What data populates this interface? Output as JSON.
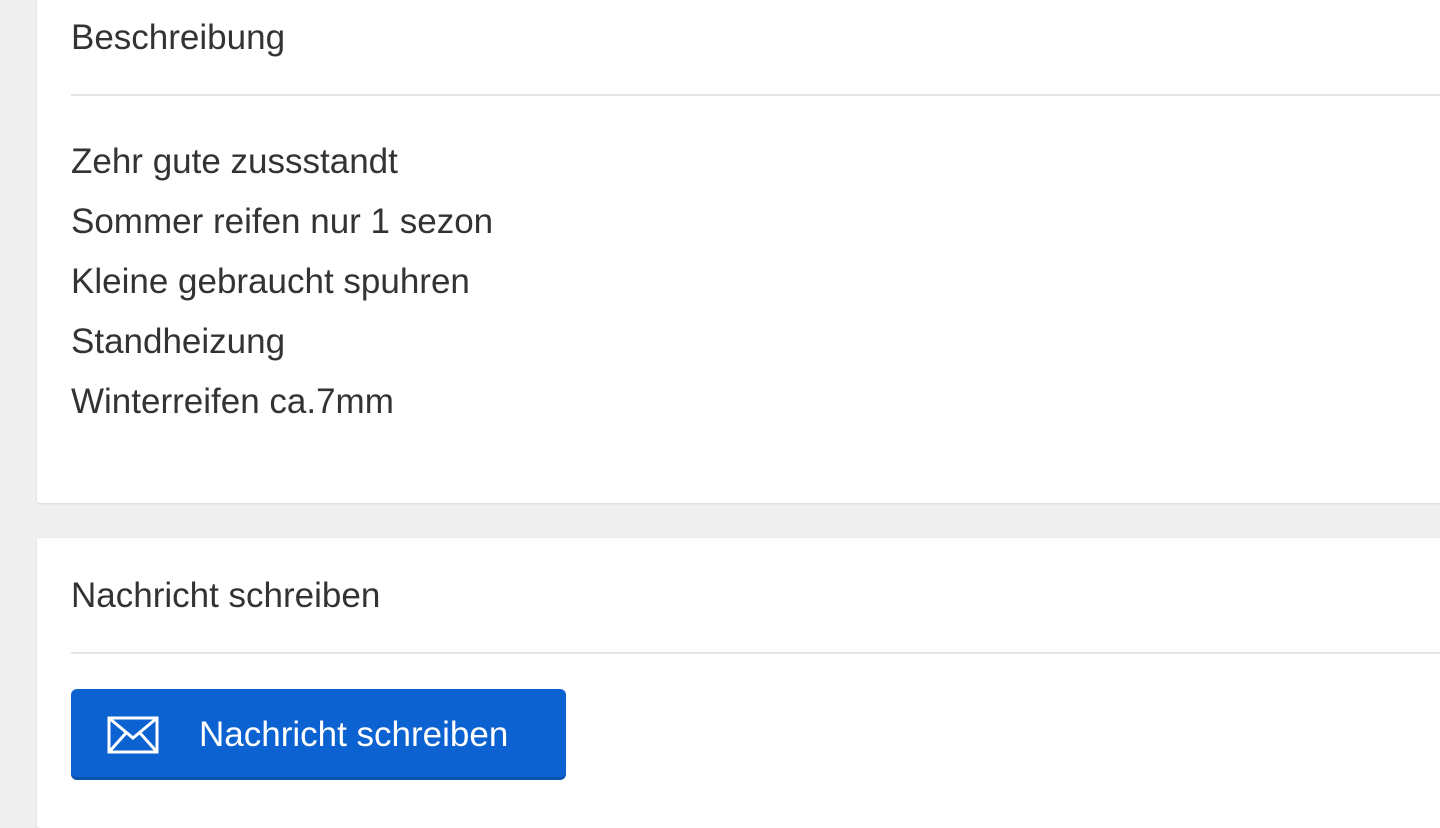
{
  "description_card": {
    "title": "Beschreibung",
    "lines": [
      "Zehr gute zussstandt",
      "Sommer reifen nur 1 sezon",
      "Kleine gebraucht spuhren",
      "Standheizung",
      "Winterreifen ca.7mm"
    ]
  },
  "message_card": {
    "title": "Nachricht schreiben",
    "button_label": "Nachricht schreiben",
    "button_icon": "envelope-icon"
  },
  "colors": {
    "page_background": "#efefef",
    "card_background": "#ffffff",
    "button_background": "#0d62d1",
    "text": "#333333"
  }
}
